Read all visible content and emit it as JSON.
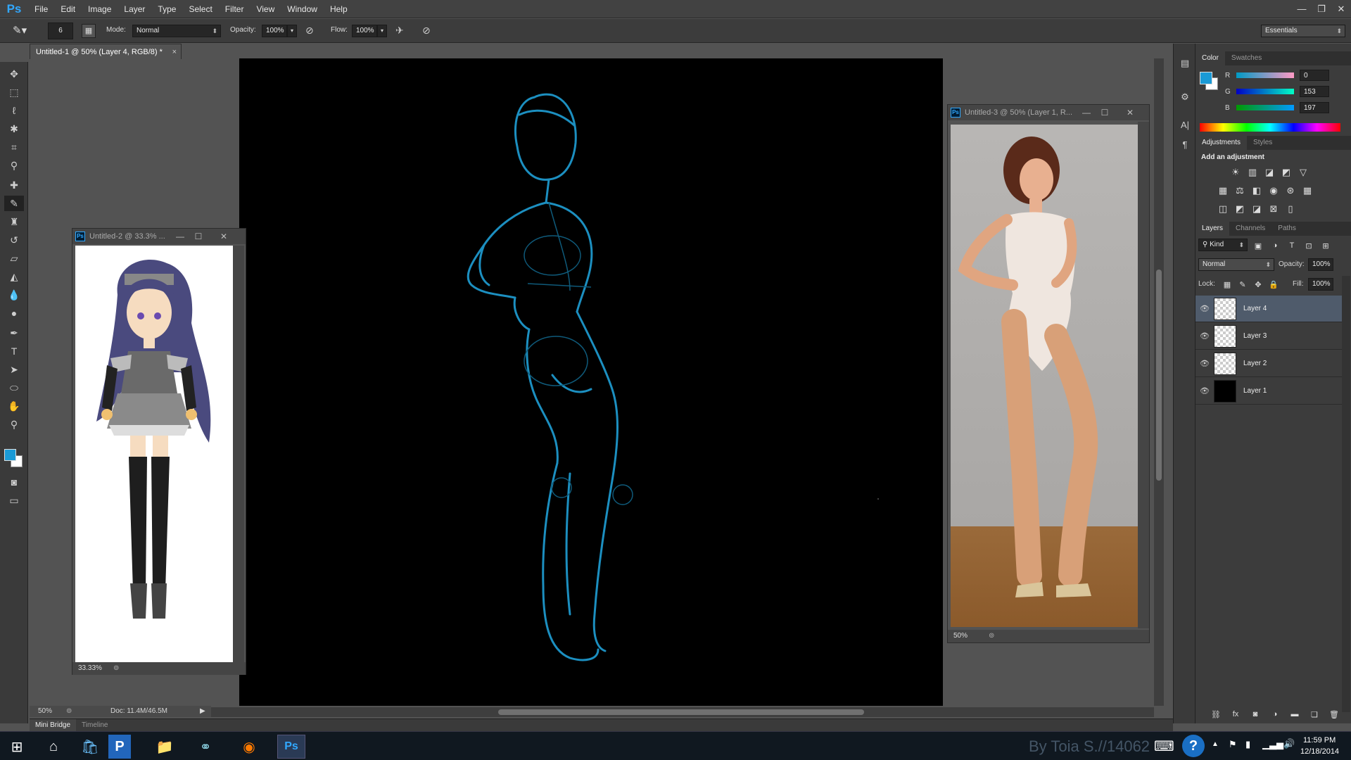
{
  "menu": {
    "logo": "Ps",
    "items": [
      "File",
      "Edit",
      "Image",
      "Layer",
      "Type",
      "Select",
      "Filter",
      "View",
      "Window",
      "Help"
    ]
  },
  "options": {
    "brush_size": "6",
    "mode_label": "Mode:",
    "mode_value": "Normal",
    "opacity_label": "Opacity:",
    "opacity_value": "100%",
    "flow_label": "Flow:",
    "flow_value": "100%",
    "workspace": "Essentials"
  },
  "main_doc": {
    "tab_title": "Untitled-1 @ 50% (Layer 4, RGB/8) *",
    "zoom": "50%",
    "doc_info": "Doc: 11.4M/46.5M"
  },
  "window2": {
    "title": "Untitled-2 @ 33.3% ...",
    "zoom": "33.33%"
  },
  "window3": {
    "title": "Untitled-3 @ 50% (Layer 1, R...",
    "zoom": "50%"
  },
  "color_panel": {
    "tabs": [
      "Color",
      "Swatches"
    ],
    "foreground": "#1a9ad6",
    "r_label": "R",
    "r_value": "0",
    "g_label": "G",
    "g_value": "153",
    "b_label": "B",
    "b_value": "197"
  },
  "adjustments_panel": {
    "tabs": [
      "Adjustments",
      "Styles"
    ],
    "heading": "Add an adjustment"
  },
  "layers_panel": {
    "tabs": [
      "Layers",
      "Channels",
      "Paths"
    ],
    "kind": "Kind",
    "blend_mode": "Normal",
    "opacity_label": "Opacity:",
    "opacity_value": "100%",
    "lock_label": "Lock:",
    "fill_label": "Fill:",
    "fill_value": "100%",
    "layers": [
      {
        "name": "Layer 4",
        "selected": true,
        "fill": "transparent"
      },
      {
        "name": "Layer 3",
        "selected": false,
        "fill": "transparent"
      },
      {
        "name": "Layer 2",
        "selected": false,
        "fill": "transparent"
      },
      {
        "name": "Layer 1",
        "selected": false,
        "fill": "black"
      }
    ]
  },
  "bottom_tabs": [
    "Mini Bridge",
    "Timeline"
  ],
  "taskbar": {
    "watermark": "By Toia S.//14062",
    "time": "11:59 PM",
    "date": "12/18/2014"
  }
}
